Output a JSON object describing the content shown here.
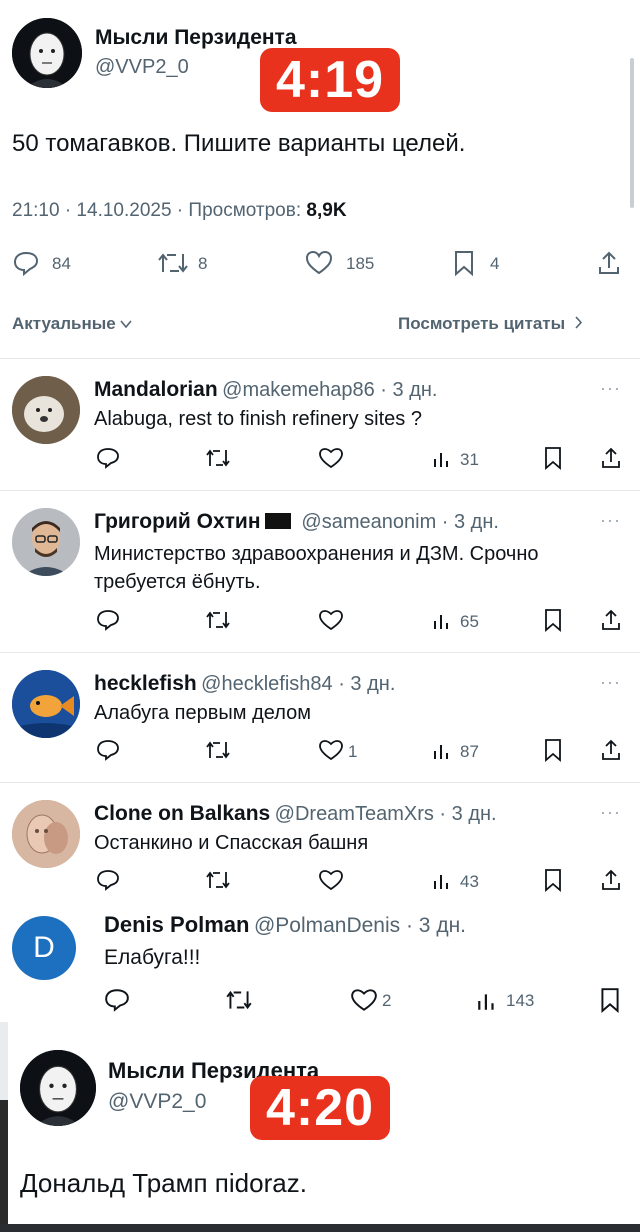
{
  "post1": {
    "author": "Мысли Перзидента",
    "handle": "@VVP2_0",
    "timer": "4:19",
    "text": "50 томагавков. Пишите варианты целей.",
    "meta": "21:10 · 14.10.2025 · Просмотров: ",
    "views": "8,9K",
    "replies": "84",
    "reposts": "8",
    "likes": "185",
    "bookmarks": "4"
  },
  "filter": {
    "sort_label": "Актуальные",
    "quotes_label": "Посмотреть цитаты"
  },
  "replies": [
    {
      "name": "Mandalorian",
      "handle": "@makemehap86 · 3 дн.",
      "text": "Alabuga, rest to finish refinery sites ?",
      "likes": "",
      "views": "31"
    },
    {
      "name": "Григорий Охтин",
      "handle": "@sameanonim · 3 дн.",
      "text": "Министерство здравоохранения и ДЗМ. Срочно требуется ёбнуть.",
      "likes": "",
      "views": "65"
    },
    {
      "name": "hecklefish",
      "handle": "@hecklefish84 · 3 дн.",
      "text": "Алабуга первым делом",
      "likes": "1",
      "views": "87"
    },
    {
      "name": "Clone on Balkans",
      "handle": "@DreamTeamXrs · 3 дн.",
      "text": "Останкино и Спасская башня",
      "likes": "",
      "views": "43"
    },
    {
      "name": "Denis Polman",
      "handle": "@PolmanDenis · 3 дн.",
      "text": "Елабуга!!!",
      "likes": "2",
      "views": "143",
      "initial": "D"
    }
  ],
  "post2": {
    "author": "Мысли Перзидента",
    "handle": "@VVP2_0",
    "timer": "4:20",
    "text": "Дональд Трамп пidoraz."
  },
  "colors": {
    "badge": "#e8321e",
    "avatar_d": "#1d6fbf",
    "text": "#0f1419",
    "secondary": "#536471"
  }
}
